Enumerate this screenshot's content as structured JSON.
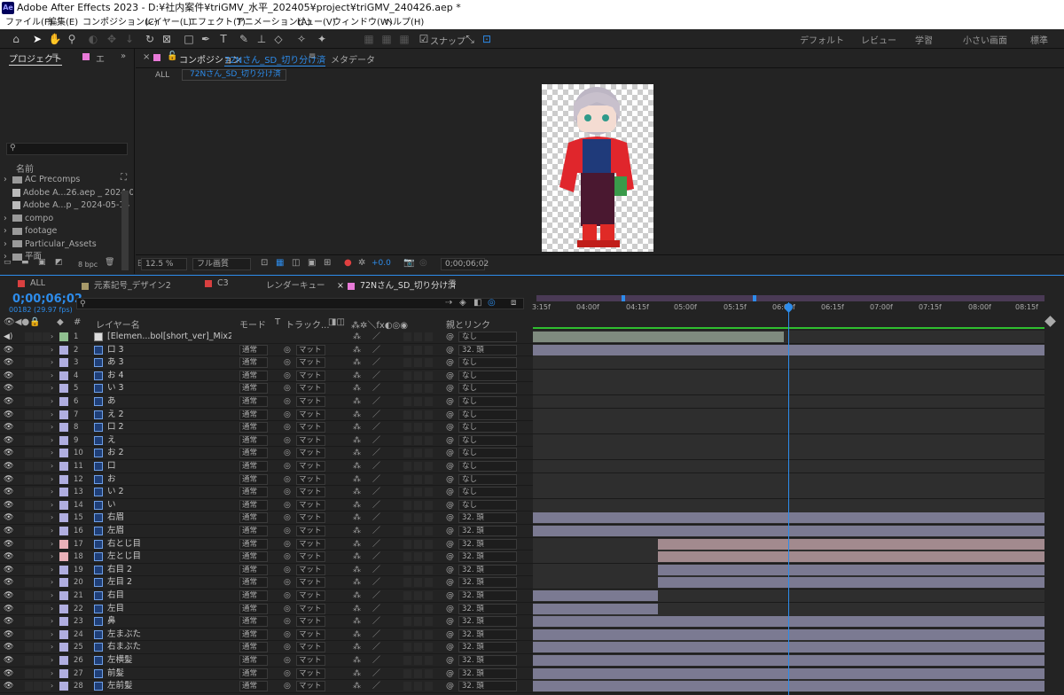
{
  "window": {
    "title": "Adobe After Effects 2023 - D:¥社内案件¥triGMV_水平_202405¥project¥triGMV_240426.aep *",
    "app_badge": "Ae"
  },
  "menu": [
    "ファイル(F)",
    "編集(E)",
    "コンポジション(C)",
    "レイヤー(L)",
    "エフェクト(T)",
    "アニメーション(A)",
    "ビュー(V)",
    "ウィンドウ(W)",
    "ヘルプ(H)"
  ],
  "toolbar": {
    "snap_label": "スナップ",
    "workspaces": [
      "デフォルト",
      "レビュー",
      "学習",
      "小さい画面",
      "標準"
    ]
  },
  "project": {
    "tab": "プロジェクト",
    "tab2": "エ",
    "column_name": "名前",
    "bpc": "8 bpc",
    "items": [
      {
        "type": "folder",
        "name": "AC Precomps"
      },
      {
        "type": "file",
        "name": "Adobe A...26.aep _ 2024-05-"
      },
      {
        "type": "file2",
        "name": "Adobe A...p _ 2024-05-14 0"
      },
      {
        "type": "folder",
        "name": "compo"
      },
      {
        "type": "folder",
        "name": "footage"
      },
      {
        "type": "folder",
        "name": "Particular_Assets"
      },
      {
        "type": "folder",
        "name": "平面"
      }
    ]
  },
  "composition": {
    "tab_prefix": "コンポジション",
    "tab_name": "72Nさん_SD_切り分け済",
    "meta_tab": "メタデータ",
    "all": "ALL",
    "flow_name": "72Nさん_SD_切り分け済",
    "zoom": "12.5 %",
    "quality": "フル画質",
    "exposure": "+0.0",
    "timecode": "0;00;06;02"
  },
  "timeline": {
    "tabs": [
      {
        "name": "ALL",
        "color": "#d94040"
      },
      {
        "name": "元素記号_デザイン2",
        "color": "#a89a6a"
      },
      {
        "name": "C3",
        "color": "#d94040"
      },
      {
        "name": "レンダーキュー",
        "color": ""
      },
      {
        "name": "72Nさん_SD_切り分け済",
        "color": "#e87ad8"
      }
    ],
    "timecode": "0;00;06;02",
    "fps": "00182 (29.97 fps)",
    "col_layer_name": "レイヤー名",
    "col_mode": "モード",
    "col_t": "T",
    "col_track": "トラック...",
    "col_parent": "親とリンク",
    "ticks": [
      "3:15f",
      "04:00f",
      "04:15f",
      "05:00f",
      "05:15f",
      "06:00f",
      "06:15f",
      "07:00f",
      "07:15f",
      "08:00f",
      "08:15f"
    ],
    "layers": [
      {
        "n": "1",
        "name": "[Elemen...bol[short_ver]_Mix2.wav]",
        "label": "#8fbf8f",
        "mode": "",
        "track": "",
        "parent": "なし",
        "bar_start": 0.0,
        "bar_end": 0.49,
        "bar_color": "#7f8b7f",
        "audio": true
      },
      {
        "n": "2",
        "name": "口 3",
        "label": "#b0aee0",
        "mode": "通常",
        "track": "マット",
        "parent": "32. 頭",
        "bar_start": 0.0,
        "bar_end": 1.0,
        "bar_color": "#7b7a92"
      },
      {
        "n": "3",
        "name": "あ 3",
        "label": "#b0aee0",
        "mode": "通常",
        "track": "マット",
        "parent": "なし",
        "bar_start": 0,
        "bar_end": 0,
        "bar_color": "#7b7a92"
      },
      {
        "n": "4",
        "name": "お 4",
        "label": "#b0aee0",
        "mode": "通常",
        "track": "マット",
        "parent": "なし",
        "bar_start": 0,
        "bar_end": 0,
        "bar_color": "#7b7a92"
      },
      {
        "n": "5",
        "name": "い 3",
        "label": "#b0aee0",
        "mode": "通常",
        "track": "マット",
        "parent": "なし",
        "bar_start": 0,
        "bar_end": 0,
        "bar_color": "#7b7a92"
      },
      {
        "n": "6",
        "name": "あ",
        "label": "#b0aee0",
        "mode": "通常",
        "track": "マット",
        "parent": "なし",
        "bar_start": 0,
        "bar_end": 0,
        "bar_color": "#7b7a92"
      },
      {
        "n": "7",
        "name": "え 2",
        "label": "#b0aee0",
        "mode": "通常",
        "track": "マット",
        "parent": "なし",
        "bar_start": 0,
        "bar_end": 0,
        "bar_color": "#7b7a92"
      },
      {
        "n": "8",
        "name": "口 2",
        "label": "#b0aee0",
        "mode": "通常",
        "track": "マット",
        "parent": "なし",
        "bar_start": 0,
        "bar_end": 0,
        "bar_color": "#7b7a92"
      },
      {
        "n": "9",
        "name": "え",
        "label": "#b0aee0",
        "mode": "通常",
        "track": "マット",
        "parent": "なし",
        "bar_start": 0,
        "bar_end": 0,
        "bar_color": "#7b7a92"
      },
      {
        "n": "10",
        "name": "お 2",
        "label": "#b0aee0",
        "mode": "通常",
        "track": "マット",
        "parent": "なし",
        "bar_start": 0,
        "bar_end": 0,
        "bar_color": "#7b7a92"
      },
      {
        "n": "11",
        "name": "口",
        "label": "#b0aee0",
        "mode": "通常",
        "track": "マット",
        "parent": "なし",
        "bar_start": 0,
        "bar_end": 0,
        "bar_color": "#7b7a92"
      },
      {
        "n": "12",
        "name": "お",
        "label": "#b0aee0",
        "mode": "通常",
        "track": "マット",
        "parent": "なし",
        "bar_start": 0,
        "bar_end": 0,
        "bar_color": "#7b7a92"
      },
      {
        "n": "13",
        "name": "い 2",
        "label": "#b0aee0",
        "mode": "通常",
        "track": "マット",
        "parent": "なし",
        "bar_start": 0,
        "bar_end": 0,
        "bar_color": "#7b7a92"
      },
      {
        "n": "14",
        "name": "い",
        "label": "#b0aee0",
        "mode": "通常",
        "track": "マット",
        "parent": "なし",
        "bar_start": 0,
        "bar_end": 0,
        "bar_color": "#7b7a92"
      },
      {
        "n": "15",
        "name": "右眉",
        "label": "#b0aee0",
        "mode": "通常",
        "track": "マット",
        "parent": "32. 頭",
        "bar_start": 0.0,
        "bar_end": 1.0,
        "bar_color": "#7b7a92"
      },
      {
        "n": "16",
        "name": "左眉",
        "label": "#b0aee0",
        "mode": "通常",
        "track": "マット",
        "parent": "32. 頭",
        "bar_start": 0.0,
        "bar_end": 1.0,
        "bar_color": "#7b7a92"
      },
      {
        "n": "17",
        "name": "右とじ目",
        "label": "#e8b0b8",
        "mode": "通常",
        "track": "マット",
        "parent": "32. 頭",
        "bar_start": 0.245,
        "bar_end": 1.0,
        "bar_color": "#a28a8e"
      },
      {
        "n": "18",
        "name": "左とじ目",
        "label": "#e8b0b8",
        "mode": "通常",
        "track": "マット",
        "parent": "32. 頭",
        "bar_start": 0.245,
        "bar_end": 1.0,
        "bar_color": "#a28a8e"
      },
      {
        "n": "19",
        "name": "右目 2",
        "label": "#b0aee0",
        "mode": "通常",
        "track": "マット",
        "parent": "32. 頭",
        "bar_start": 0.245,
        "bar_end": 1.0,
        "bar_color": "#7b7a92"
      },
      {
        "n": "20",
        "name": "左目 2",
        "label": "#b0aee0",
        "mode": "通常",
        "track": "マット",
        "parent": "32. 頭",
        "bar_start": 0.245,
        "bar_end": 1.0,
        "bar_color": "#7b7a92"
      },
      {
        "n": "21",
        "name": "右目",
        "label": "#b0aee0",
        "mode": "通常",
        "track": "マット",
        "parent": "32. 頭",
        "bar_start": 0.0,
        "bar_end": 0.245,
        "bar_color": "#7b7a92"
      },
      {
        "n": "22",
        "name": "左目",
        "label": "#b0aee0",
        "mode": "通常",
        "track": "マット",
        "parent": "32. 頭",
        "bar_start": 0.0,
        "bar_end": 0.245,
        "bar_color": "#7b7a92"
      },
      {
        "n": "23",
        "name": "鼻",
        "label": "#b0aee0",
        "mode": "通常",
        "track": "マット",
        "parent": "32. 頭",
        "bar_start": 0.0,
        "bar_end": 1.0,
        "bar_color": "#7b7a92"
      },
      {
        "n": "24",
        "name": "左まぶた",
        "label": "#b0aee0",
        "mode": "通常",
        "track": "マット",
        "parent": "32. 頭",
        "bar_start": 0.0,
        "bar_end": 1.0,
        "bar_color": "#7b7a92"
      },
      {
        "n": "25",
        "name": "右まぶた",
        "label": "#b0aee0",
        "mode": "通常",
        "track": "マット",
        "parent": "32. 頭",
        "bar_start": 0.0,
        "bar_end": 1.0,
        "bar_color": "#7b7a92"
      },
      {
        "n": "26",
        "name": "左横髪",
        "label": "#b0aee0",
        "mode": "通常",
        "track": "マット",
        "parent": "32. 頭",
        "bar_start": 0.0,
        "bar_end": 1.0,
        "bar_color": "#7b7a92"
      },
      {
        "n": "27",
        "name": "前髪",
        "label": "#b0aee0",
        "mode": "通常",
        "track": "マット",
        "parent": "32. 頭",
        "bar_start": 0.0,
        "bar_end": 1.0,
        "bar_color": "#7b7a92"
      },
      {
        "n": "28",
        "name": "左前髪",
        "label": "#b0aee0",
        "mode": "通常",
        "track": "マット",
        "parent": "32. 頭",
        "bar_start": 0.0,
        "bar_end": 1.0,
        "bar_color": "#7b7a92"
      }
    ]
  }
}
